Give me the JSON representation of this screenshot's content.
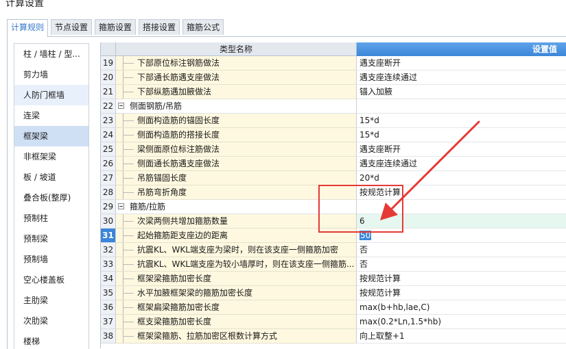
{
  "window": {
    "title": "计算设置"
  },
  "tabs": [
    {
      "label": "计算规则",
      "active": true
    },
    {
      "label": "节点设置",
      "active": false
    },
    {
      "label": "箍筋设置",
      "active": false
    },
    {
      "label": "搭接设置",
      "active": false
    },
    {
      "label": "箍筋公式",
      "active": false
    }
  ],
  "sidebar": {
    "items": [
      {
        "label": "柱 / 墙柱 / 型..."
      },
      {
        "label": "剪力墙"
      },
      {
        "label": "人防门框墙"
      },
      {
        "label": "连梁"
      },
      {
        "label": "框架梁"
      },
      {
        "label": "非框架梁"
      },
      {
        "label": "板 / 坡道"
      },
      {
        "label": "叠合板(整厚)"
      },
      {
        "label": "预制柱"
      },
      {
        "label": "预制梁"
      },
      {
        "label": "预制墙"
      },
      {
        "label": "空心楼盖板"
      },
      {
        "label": "主肋梁"
      },
      {
        "label": "次肋梁"
      },
      {
        "label": "楼梯"
      }
    ]
  },
  "grid": {
    "header_name": "类型名称",
    "header_value": "设置值",
    "rows": [
      {
        "num": "19",
        "name": "下部原位标注钢筋做法",
        "value": "遇支座断开"
      },
      {
        "num": "20",
        "name": "下部通长筋遇支座做法",
        "value": "遇支座连续通过"
      },
      {
        "num": "21",
        "name": "下部纵筋遇加腋做法",
        "value": "锚入加腋"
      },
      {
        "num": "22",
        "name": "侧面钢筋/吊筋",
        "value": ""
      },
      {
        "num": "23",
        "name": "侧面构造筋的锚固长度",
        "value": "15*d"
      },
      {
        "num": "24",
        "name": "侧面构造筋的搭接长度",
        "value": "15*d"
      },
      {
        "num": "25",
        "name": "梁侧面原位标注筋做法",
        "value": "遇支座断开"
      },
      {
        "num": "26",
        "name": "侧面通长筋遇支座做法",
        "value": "遇支座连续通过"
      },
      {
        "num": "27",
        "name": "吊筋锚固长度",
        "value": "20*d"
      },
      {
        "num": "28",
        "name": "吊筋弯折角度",
        "value": "按规范计算"
      },
      {
        "num": "29",
        "name": "箍筋/拉筋",
        "value": ""
      },
      {
        "num": "30",
        "name": "次梁两侧共增加箍筋数量",
        "value": "6"
      },
      {
        "num": "31",
        "name": "起始箍筋距支座边的距离",
        "value": "50"
      },
      {
        "num": "32",
        "name": "抗震KL、WKL端支座为梁时，则在该支座一侧箍筋加密",
        "value": "否"
      },
      {
        "num": "33",
        "name": "抗震KL、WKL端支座为较小墙厚时，则在该支座一侧箍筋...",
        "value": "否"
      },
      {
        "num": "34",
        "name": "框架梁箍筋加密长度",
        "value": "按规范计算"
      },
      {
        "num": "35",
        "name": "水平加腋框架梁的箍筋加密长度",
        "value": "按规范计算"
      },
      {
        "num": "36",
        "name": "框架扁梁箍筋加密长度",
        "value": "max(b+hb,lae,C)"
      },
      {
        "num": "37",
        "name": "框支梁箍筋加密长度",
        "value": "max(0.2*Ln,1.5*hb)"
      },
      {
        "num": "38",
        "name": "框架梁箍筋、拉筋加密区根数计算方式",
        "value": "向上取整+1"
      }
    ]
  },
  "colors": {
    "accent": "#3b86d8",
    "annotation": "#e53935",
    "name_cell_bg": "#fdf8df",
    "editing_row_bg": "#e6f7ef"
  }
}
